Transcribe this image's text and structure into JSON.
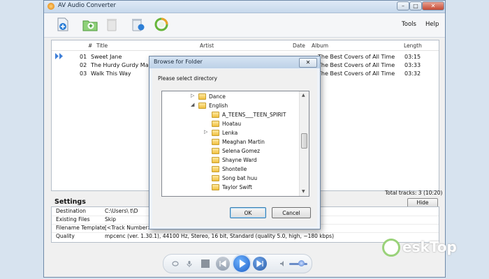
{
  "window": {
    "title": "AV Audio Converter",
    "controls": {
      "minimize": "–",
      "maximize": "□",
      "close": "✕"
    }
  },
  "toolbar": {
    "icons": [
      "add-file-icon",
      "add-folder-icon",
      "remove-icon",
      "clear-list-icon",
      "convert-icon"
    ],
    "menu": {
      "tools": "Tools",
      "help": "Help"
    }
  },
  "tracklist": {
    "columns": {
      "num": "#",
      "title": "Title",
      "artist": "Artist",
      "date": "Date",
      "album": "Album",
      "length": "Length"
    },
    "rows": [
      {
        "num": "01",
        "title": "Sweet Jane",
        "album": "The Best Covers of All Time",
        "length": "03:15"
      },
      {
        "num": "02",
        "title": "The Hurdy Gurdy Man",
        "album": "The Best Covers of All Time",
        "length": "03:33"
      },
      {
        "num": "03",
        "title": "Walk This Way",
        "album": "The Best Covers of All Time",
        "length": "03:32"
      }
    ],
    "total": "Total tracks: 3 (10:20)"
  },
  "settings": {
    "title": "Settings",
    "hide_label": "Hide",
    "rows": [
      {
        "label": "Destination",
        "value": "C:\\Users\\     t\\D"
      },
      {
        "label": "Existing Files",
        "value": "Skip"
      },
      {
        "label": "Filename Template",
        "value": "[<Track Number>"
      },
      {
        "label": "Quality",
        "value": "mpcenc (ver. 1.30.1), 44100 Hz, Stereo, 16 bit, Standard (quality 5.0, high, ~180 kbps)"
      }
    ]
  },
  "dialog": {
    "title": "Browse for Folder",
    "close": "✕",
    "prompt": "Please select directory",
    "tree": [
      {
        "label": "Dance",
        "expander": "▷"
      },
      {
        "label": "English",
        "expander": "◢"
      },
      {
        "label": "A_TEENS___TEEN_SPIRIT",
        "expander": ""
      },
      {
        "label": "Hoatau",
        "expander": ""
      },
      {
        "label": "Lenka",
        "expander": "▷"
      },
      {
        "label": "Meaghan Martin",
        "expander": ""
      },
      {
        "label": "Selena Gomez",
        "expander": ""
      },
      {
        "label": "Shayne Ward",
        "expander": ""
      },
      {
        "label": "Shontelle",
        "expander": ""
      },
      {
        "label": "Song bat huu",
        "expander": ""
      },
      {
        "label": "Taylor Swift",
        "expander": ""
      }
    ],
    "ok_label": "OK",
    "cancel_label": "Cancel"
  },
  "player": {
    "icons": [
      "loop-icon",
      "microphone-icon",
      "stop-icon",
      "previous-icon",
      "play-icon",
      "next-icon",
      "volume-icon"
    ],
    "volume": 0.55
  },
  "watermark": {
    "text": "eskTop"
  },
  "colors": {
    "accent": "#1d5fc6",
    "folder": "#f0c040",
    "title_bar": "#c6d8ec"
  }
}
